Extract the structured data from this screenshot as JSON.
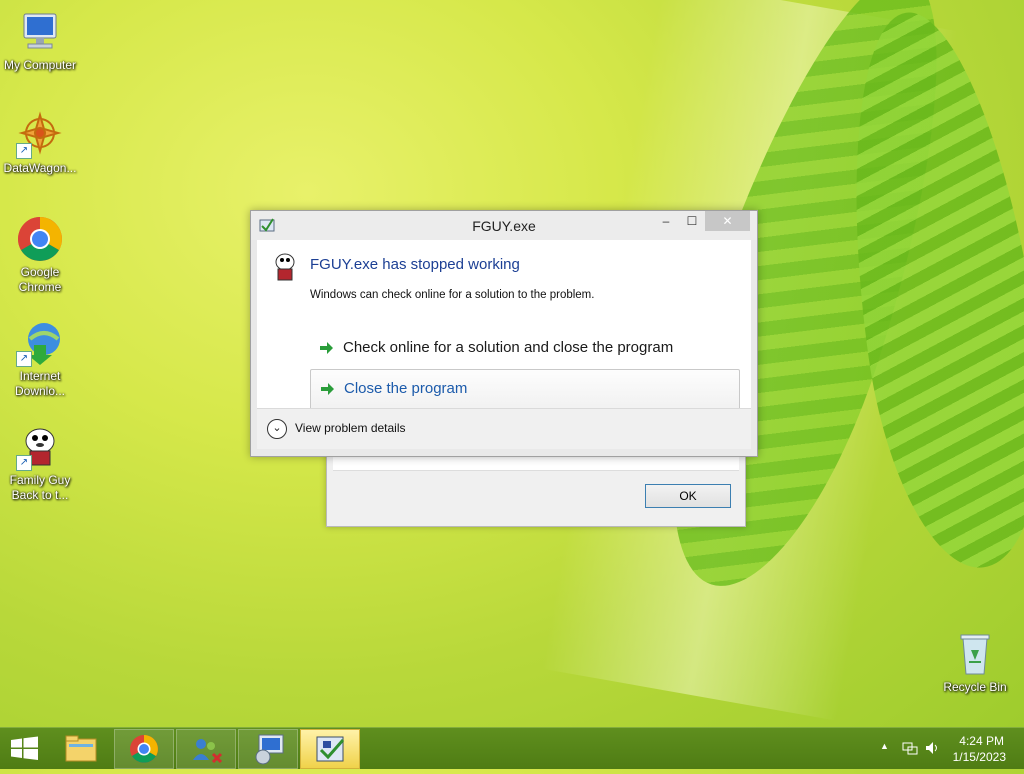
{
  "desktop": {
    "icons": [
      {
        "label": "My Computer",
        "icon": "computer-icon"
      },
      {
        "label": "DataWagon...",
        "icon": "datawagon-icon"
      },
      {
        "label": "Google Chrome",
        "icon": "chrome-icon"
      },
      {
        "label": "Internet Downlo...",
        "icon": "internet-download-icon"
      },
      {
        "label": "Family Guy Back to t...",
        "icon": "family-guy-icon"
      }
    ],
    "recycle_bin": {
      "label": "Recycle Bin",
      "icon": "recycle-bin-icon"
    }
  },
  "error_dialog": {
    "title": "FGUY.exe",
    "main_instruction": "FGUY.exe has stopped working",
    "sub_instruction": "Windows can check online for a solution to the problem.",
    "commands": [
      {
        "label": "Check online for a solution and close the program"
      },
      {
        "label": "Close the program"
      }
    ],
    "details_label": "View problem details",
    "minimize_symbol": "‒",
    "maximize_symbol": "☐",
    "close_symbol": "✕"
  },
  "background_dialog": {
    "ok_label": "OK"
  },
  "taskbar": {
    "items": [
      {
        "icon": "windows-start-icon"
      },
      {
        "icon": "file-explorer-icon"
      },
      {
        "icon": "chrome-icon"
      },
      {
        "icon": "network-tool-icon"
      },
      {
        "icon": "setup-program-icon"
      },
      {
        "icon": "fguy-program-icon",
        "active": true
      }
    ],
    "tray": {
      "time": "4:24 PM",
      "date": "1/15/2023",
      "show_hidden": "▲"
    }
  },
  "colors": {
    "dialog_title_blue": "#1c3f94",
    "link_blue": "#1c5bab",
    "taskbar_green": "#5f8f1e",
    "active_item_yellow": "#f0d24a"
  }
}
